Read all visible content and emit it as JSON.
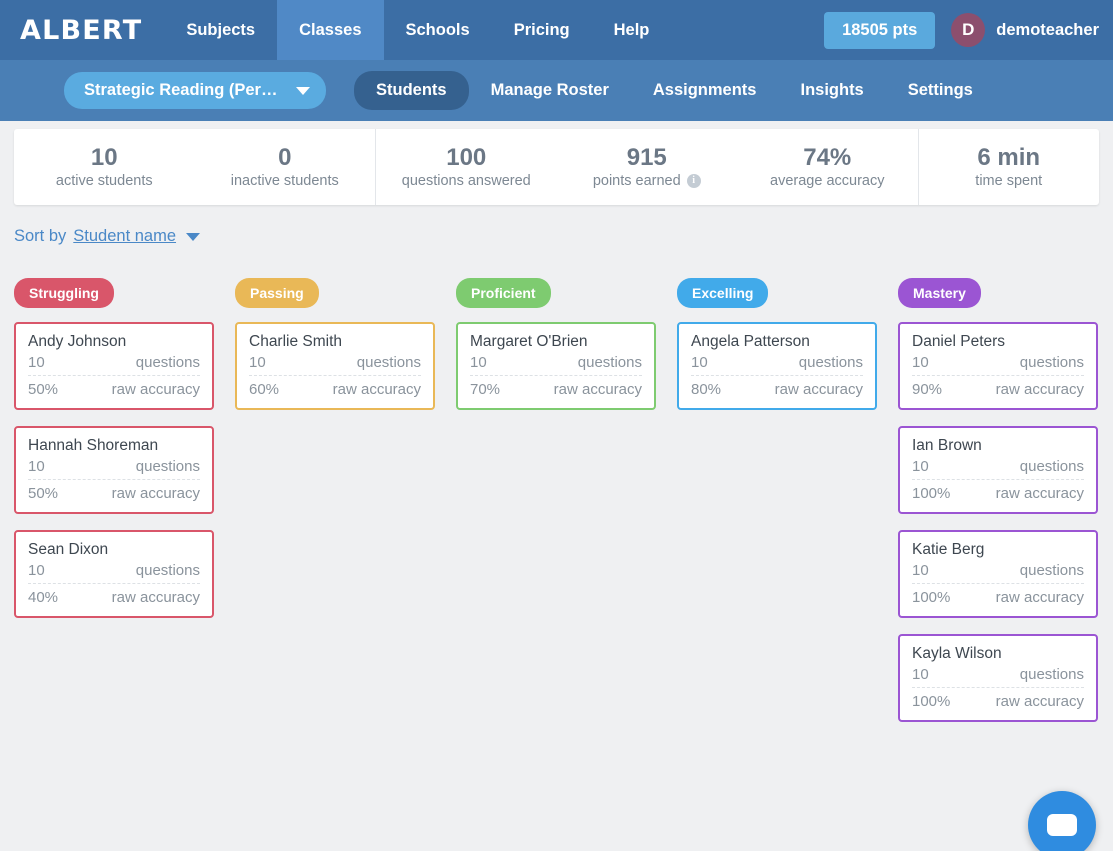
{
  "header": {
    "brand": "ALBERT",
    "nav_items": [
      {
        "label": "Subjects",
        "active": false
      },
      {
        "label": "Classes",
        "active": true
      },
      {
        "label": "Schools",
        "active": false
      },
      {
        "label": "Pricing",
        "active": false
      },
      {
        "label": "Help",
        "active": false
      }
    ],
    "points_badge": "18505 pts",
    "avatar_initial": "D",
    "user_name": "demoteacher"
  },
  "subnav": {
    "class_selector": "Strategic Reading (Peri...",
    "tabs": [
      {
        "label": "Students",
        "active": true
      },
      {
        "label": "Manage Roster",
        "active": false
      },
      {
        "label": "Assignments",
        "active": false
      },
      {
        "label": "Insights",
        "active": false
      },
      {
        "label": "Settings",
        "active": false
      }
    ]
  },
  "stats": [
    {
      "value": "10",
      "label": "active students",
      "info": false
    },
    {
      "value": "0",
      "label": "inactive students",
      "info": false
    },
    {
      "value": "100",
      "label": "questions answered",
      "info": false
    },
    {
      "value": "915",
      "label": "points earned",
      "info": true
    },
    {
      "value": "74%",
      "label": "average accuracy",
      "info": false
    },
    {
      "value": "6 min",
      "label": "time spent",
      "info": false
    }
  ],
  "sort": {
    "prefix": "Sort by",
    "value": "Student name"
  },
  "columns": [
    {
      "name": "Struggling",
      "color": "#d9566a",
      "students": [
        {
          "name": "Andy Johnson",
          "questions": "10",
          "questions_label": "questions",
          "accuracy": "50%",
          "accuracy_label": "raw accuracy"
        },
        {
          "name": "Hannah Shoreman",
          "questions": "10",
          "questions_label": "questions",
          "accuracy": "50%",
          "accuracy_label": "raw accuracy"
        },
        {
          "name": "Sean Dixon",
          "questions": "10",
          "questions_label": "questions",
          "accuracy": "40%",
          "accuracy_label": "raw accuracy"
        }
      ]
    },
    {
      "name": "Passing",
      "color": "#e9b857",
      "students": [
        {
          "name": "Charlie Smith",
          "questions": "10",
          "questions_label": "questions",
          "accuracy": "60%",
          "accuracy_label": "raw accuracy"
        }
      ]
    },
    {
      "name": "Proficient",
      "color": "#7ecb70",
      "students": [
        {
          "name": "Margaret O'Brien",
          "questions": "10",
          "questions_label": "questions",
          "accuracy": "70%",
          "accuracy_label": "raw accuracy"
        }
      ]
    },
    {
      "name": "Excelling",
      "color": "#41aaea",
      "students": [
        {
          "name": "Angela Patterson",
          "questions": "10",
          "questions_label": "questions",
          "accuracy": "80%",
          "accuracy_label": "raw accuracy"
        }
      ]
    },
    {
      "name": "Mastery",
      "color": "#9b55d3",
      "students": [
        {
          "name": "Daniel Peters",
          "questions": "10",
          "questions_label": "questions",
          "accuracy": "90%",
          "accuracy_label": "raw accuracy"
        },
        {
          "name": "Ian Brown",
          "questions": "10",
          "questions_label": "questions",
          "accuracy": "100%",
          "accuracy_label": "raw accuracy"
        },
        {
          "name": "Katie Berg",
          "questions": "10",
          "questions_label": "questions",
          "accuracy": "100%",
          "accuracy_label": "raw accuracy"
        },
        {
          "name": "Kayla Wilson",
          "questions": "10",
          "questions_label": "questions",
          "accuracy": "100%",
          "accuracy_label": "raw accuracy"
        }
      ]
    }
  ],
  "chat": {
    "icon": "chat-bubble-icon"
  },
  "info_icon_glyph": "i"
}
